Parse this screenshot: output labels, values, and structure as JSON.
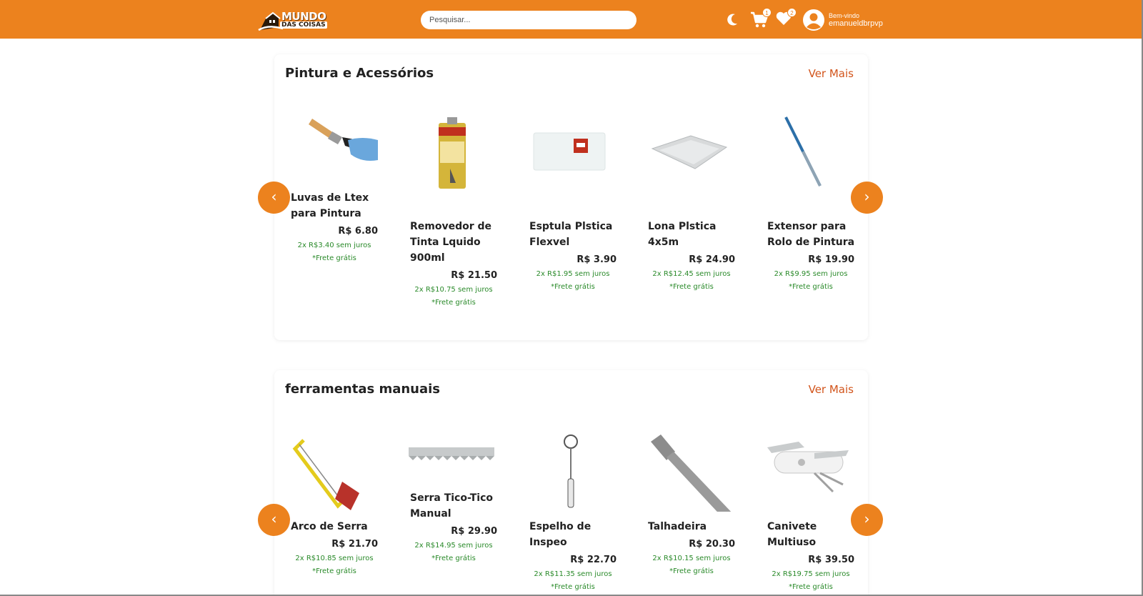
{
  "header": {
    "brand_line1": "MUNDO",
    "brand_line2": "DAS COISAS",
    "search_placeholder": "Pesquisar...",
    "cart_count": "1",
    "favorites_count": "2",
    "welcome_label": "Bem-vindo",
    "username": "emanueldbrpvp",
    "accent_color": "#ec821e"
  },
  "sections": [
    {
      "title": "Pintura e Acessórios",
      "more_label": "Ver Mais",
      "prev_label": "‹",
      "next_label": "›",
      "products": [
        {
          "name": "Luvas de Ltex para Pintura",
          "price": "R$ 6.80",
          "installments": "2x R$3.40 sem juros",
          "shipping": "*Frete grátis",
          "icon": "paint-brush-icon"
        },
        {
          "name": "Removedor de Tinta Lquido 900ml",
          "price": "R$ 21.50",
          "installments": "2x R$10.75 sem juros",
          "shipping": "*Frete grátis",
          "icon": "paint-remover-can-icon"
        },
        {
          "name": "Esptula Plstica Flexvel",
          "price": "R$ 3.90",
          "installments": "2x R$1.95 sem juros",
          "shipping": "*Frete grátis",
          "icon": "plastic-spatula-icon"
        },
        {
          "name": "Lona Plstica 4x5m",
          "price": "R$ 24.90",
          "installments": "2x R$12.45 sem juros",
          "shipping": "*Frete grátis",
          "icon": "plastic-tarp-icon"
        },
        {
          "name": "Extensor para Rolo de Pintura",
          "price": "R$ 19.90",
          "installments": "2x R$9.95 sem juros",
          "shipping": "*Frete grátis",
          "icon": "extension-pole-icon"
        }
      ]
    },
    {
      "title": "ferramentas manuais",
      "more_label": "Ver Mais",
      "prev_label": "‹",
      "next_label": "›",
      "products": [
        {
          "name": "Arco de Serra",
          "price": "R$ 21.70",
          "installments": "2x R$10.85 sem juros",
          "shipping": "*Frete grátis",
          "icon": "hacksaw-icon"
        },
        {
          "name": "Serra Tico-Tico Manual",
          "price": "R$ 29.90",
          "installments": "2x R$14.95 sem juros",
          "shipping": "*Frete grátis",
          "icon": "saw-blade-icon"
        },
        {
          "name": "Espelho de Inspeo",
          "price": "R$ 22.70",
          "installments": "2x R$11.35 sem juros",
          "shipping": "*Frete grátis",
          "icon": "inspection-mirror-icon"
        },
        {
          "name": "Talhadeira",
          "price": "R$ 20.30",
          "installments": "2x R$10.15 sem juros",
          "shipping": "*Frete grátis",
          "icon": "chisel-icon"
        },
        {
          "name": "Canivete Multiuso",
          "price": "R$ 39.50",
          "installments": "2x R$19.75 sem juros",
          "shipping": "*Frete grátis",
          "icon": "pocket-knife-icon"
        }
      ]
    }
  ]
}
